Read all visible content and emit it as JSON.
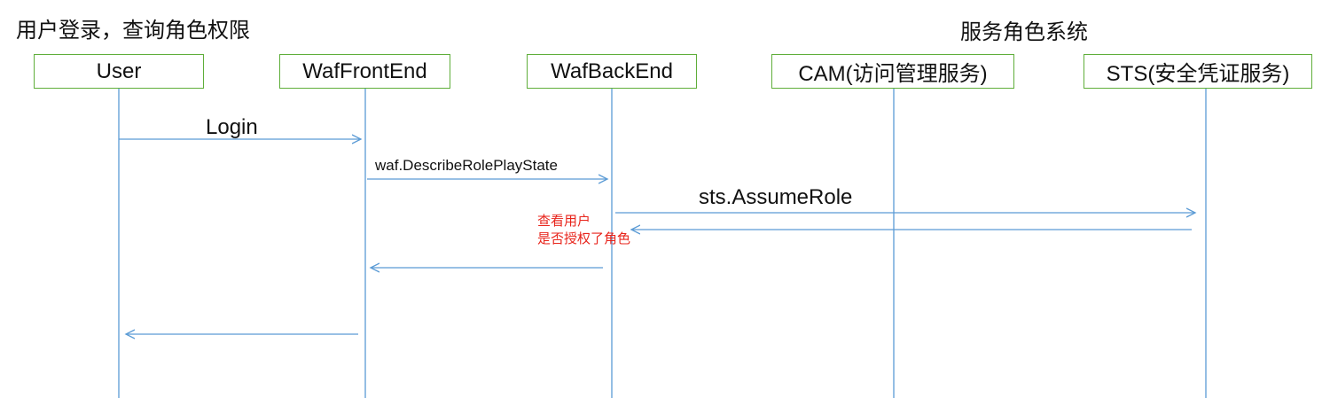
{
  "header": {
    "left_title": "用户登录，查询角色权限",
    "right_title": "服务角色系统"
  },
  "actors": [
    {
      "label": "User"
    },
    {
      "label": "WafFrontEnd"
    },
    {
      "label": "WafBackEnd"
    },
    {
      "label": "CAM(访问管理服务)"
    },
    {
      "label": "STS(安全凭证服务)"
    }
  ],
  "messages": [
    {
      "label": "Login",
      "from": 0,
      "to": 1
    },
    {
      "label": "waf.DescribeRolePlayState",
      "from": 1,
      "to": 2
    },
    {
      "label": "sts.AssumeRole",
      "from": 2,
      "to": 4
    },
    {
      "label": "",
      "from": 4,
      "to": 2
    },
    {
      "label": "",
      "from": 2,
      "to": 1
    },
    {
      "label": "",
      "from": 1,
      "to": 0
    }
  ],
  "note": {
    "line1": "查看用户",
    "line2": "是否授权了角色"
  },
  "colors": {
    "actor_border": "#5fae3a",
    "lifeline": "#5b9bd5",
    "arrow": "#5b9bd5",
    "note_text": "#e8251c"
  }
}
